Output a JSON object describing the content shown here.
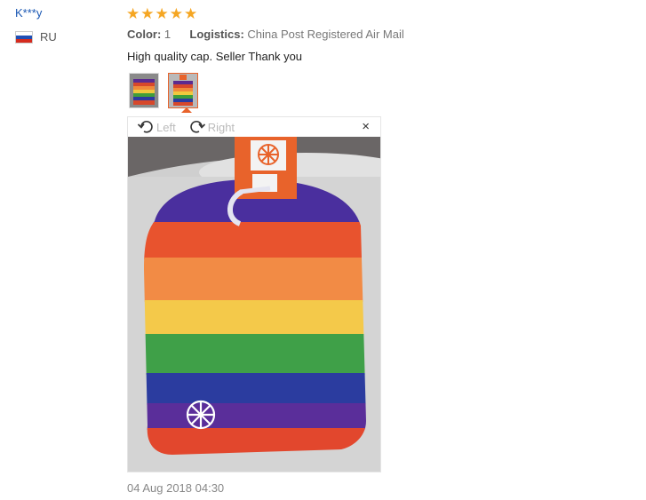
{
  "review": {
    "user": "K***y",
    "country": "RU",
    "rating": 5,
    "star_glyph": "★",
    "color_label": "Color:",
    "color_value": "1",
    "logistics_label": "Logistics:",
    "logistics_value": "China Post Registered Air Mail",
    "text": "High quality cap. Seller Thank you",
    "date": "04 Aug 2018 04:30"
  },
  "viewer": {
    "rotate_left_label": "Left",
    "rotate_right_label": "Right",
    "close_glyph": "×"
  },
  "colors": {
    "username": "#1a57b3",
    "star": "#f5a623",
    "accent": "#e8632b"
  }
}
